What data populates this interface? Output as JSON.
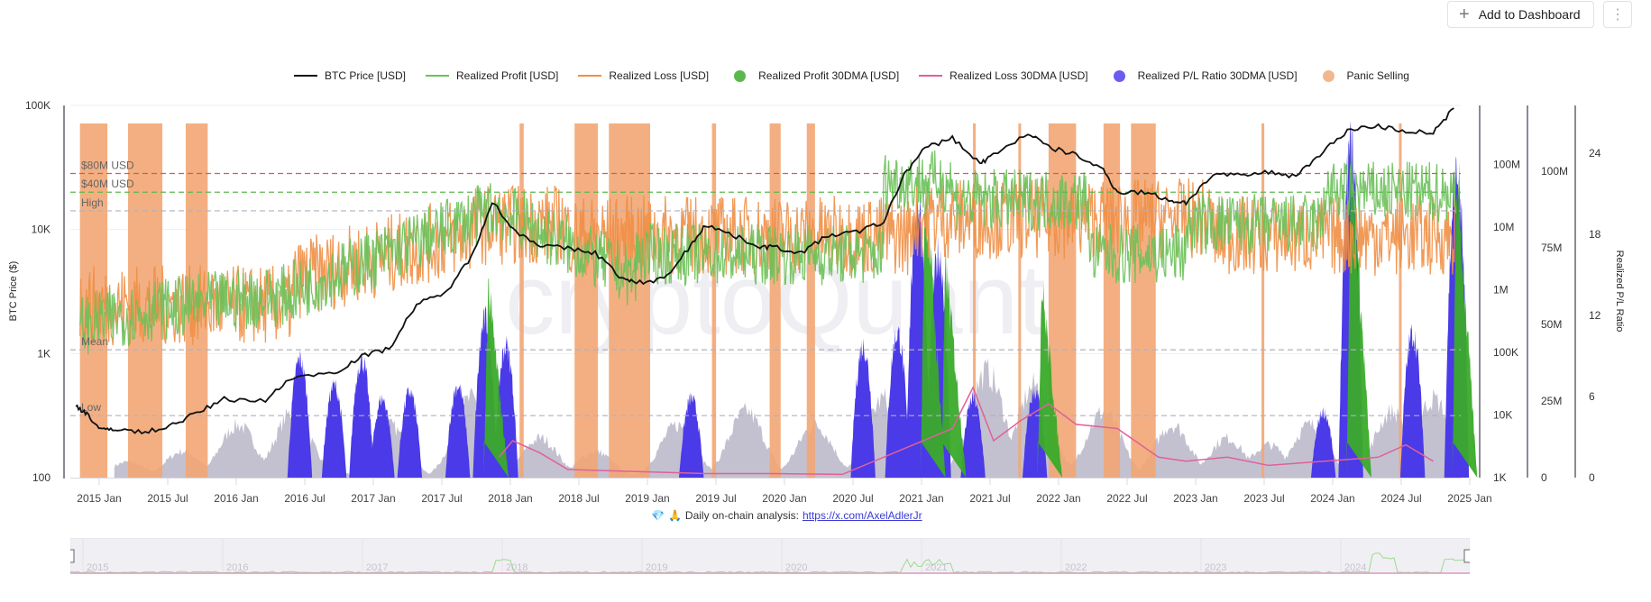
{
  "toolbar": {
    "add_dashboard_label": "Add to Dashboard",
    "add_icon": "plus-icon",
    "more_icon": "kebab-menu-icon"
  },
  "legend": [
    {
      "label": "BTC Price [USD]",
      "color": "#111111",
      "marker": "line"
    },
    {
      "label": "Realized Profit [USD]",
      "color": "#6cc15a",
      "marker": "line"
    },
    {
      "label": "Realized Loss [USD]",
      "color": "#ef8f45",
      "marker": "line"
    },
    {
      "label": "Realized Profit 30DMA [USD]",
      "color": "#5cb84c",
      "marker": "dot"
    },
    {
      "label": "Realized Loss 30DMA [USD]",
      "color": "#e0609a",
      "marker": "line"
    },
    {
      "label": "Realized P/L Ratio 30DMA [USD]",
      "color": "#6a5cf0",
      "marker": "dot"
    },
    {
      "label": "Panic Selling",
      "color": "#f2b78e",
      "marker": "dot"
    }
  ],
  "attribution": {
    "prefix": "Daily on-chain analysis:",
    "link": "https://x.com/AxelAdlerJr",
    "icons": [
      "diamond-icon",
      "praying-person-icon"
    ]
  },
  "watermark": "cryptoQuant",
  "chart_data": {
    "type": "line",
    "title": "",
    "x_range": [
      "2014-11",
      "2025-01"
    ],
    "x_ticks": [
      "2015 Jan",
      "2015 Jul",
      "2016 Jan",
      "2016 Jul",
      "2017 Jan",
      "2017 Jul",
      "2018 Jan",
      "2018 Jul",
      "2019 Jan",
      "2019 Jul",
      "2020 Jan",
      "2020 Jul",
      "2021 Jan",
      "2021 Jul",
      "2022 Jan",
      "2022 Jul",
      "2023 Jan",
      "2023 Jul",
      "2024 Jan",
      "2024 Jul",
      "2025 Jan"
    ],
    "axes": {
      "left": {
        "label": "BTC Price ($)",
        "scale": "log",
        "range": [
          100,
          100000
        ],
        "ticks": [
          "100",
          "1K",
          "10K",
          "100K"
        ]
      },
      "right1": {
        "label": "",
        "scale": "log",
        "range": [
          1000,
          1000000000
        ],
        "ticks": [
          "1K",
          "10K",
          "100K",
          "1M",
          "10M",
          "100M"
        ]
      },
      "right2": {
        "label": "",
        "scale": "linear",
        "range": [
          0,
          125000000
        ],
        "ticks": [
          "0",
          "25M",
          "50M",
          "75M",
          "100M"
        ]
      },
      "right3": {
        "label": "Realized P/L Ratio",
        "scale": "linear",
        "range": [
          0,
          27
        ],
        "ticks": [
          "0",
          "6",
          "12",
          "18",
          "24"
        ]
      }
    },
    "reference_lines": [
      {
        "label": "$80M USD",
        "axis": "right1",
        "value": 80000000,
        "color": "#e05555"
      },
      {
        "label": "$40M USD",
        "axis": "right1",
        "value": 40000000,
        "color": "#5cb84c"
      },
      {
        "label": "High",
        "axis": "right1",
        "value": 20000000,
        "color": "#b0b0c0"
      },
      {
        "label": "Mean",
        "axis": "right1",
        "value": 115000,
        "color": "#b0b0c0"
      },
      {
        "label": "Low",
        "axis": "right1",
        "value": 10000,
        "color": "#b0b0c0"
      }
    ],
    "series": [
      {
        "name": "BTC Price [USD]",
        "axis": "left",
        "color": "#111111",
        "x": [
          2014.92,
          2015.0,
          2015.1,
          2015.2,
          2015.4,
          2015.6,
          2015.8,
          2016.0,
          2016.3,
          2016.5,
          2016.8,
          2017.0,
          2017.2,
          2017.4,
          2017.6,
          2017.8,
          2017.95,
          2018.1,
          2018.3,
          2018.5,
          2018.7,
          2018.9,
          2019.0,
          2019.2,
          2019.4,
          2019.5,
          2019.7,
          2019.9,
          2020.0,
          2020.2,
          2020.4,
          2020.6,
          2020.8,
          2020.95,
          2021.1,
          2021.3,
          2021.5,
          2021.6,
          2021.85,
          2022.0,
          2022.2,
          2022.4,
          2022.5,
          2022.7,
          2022.9,
          2023.0,
          2023.2,
          2023.4,
          2023.6,
          2023.8,
          2024.0,
          2024.2,
          2024.4,
          2024.6,
          2024.8,
          2024.95
        ],
        "values": [
          380,
          330,
          240,
          250,
          230,
          260,
          330,
          430,
          420,
          650,
          700,
          950,
          1100,
          2500,
          3000,
          6000,
          17000,
          10000,
          7500,
          7000,
          6500,
          4000,
          3700,
          4000,
          7500,
          11000,
          9000,
          7300,
          7200,
          6500,
          9000,
          9500,
          11500,
          28000,
          45000,
          55000,
          34000,
          40000,
          60000,
          46000,
          40000,
          30000,
          20000,
          20000,
          17000,
          16500,
          28000,
          27000,
          29000,
          27000,
          43000,
          65000,
          68000,
          62000,
          60000,
          95000
        ]
      },
      {
        "name": "Realized Profit [USD]",
        "axis": "right1",
        "color": "#6cc15a",
        "note": "noisy daily values, approx envelope 1e5–5e8"
      },
      {
        "name": "Realized Loss [USD]",
        "axis": "right1",
        "color": "#ef8f45",
        "note": "noisy daily values, approx envelope 1e5–2e8"
      },
      {
        "name": "Realized Profit 30DMA [USD]",
        "axis": "right2",
        "color": "#3aaa2a",
        "spikes": [
          [
            2017.92,
            70000000
          ],
          [
            2021.1,
            108000000
          ],
          [
            2021.25,
            78000000
          ],
          [
            2021.95,
            70000000
          ],
          [
            2024.2,
            120000000
          ],
          [
            2024.97,
            110000000
          ]
        ]
      },
      {
        "name": "Realized Loss 30DMA [USD]",
        "axis": "right2",
        "color": "#e0609a",
        "x": [
          2018.0,
          2018.1,
          2018.3,
          2018.5,
          2019.0,
          2019.5,
          2020.0,
          2020.5,
          2021.3,
          2021.45,
          2021.6,
          2021.8,
          2022.0,
          2022.2,
          2022.5,
          2022.8,
          2023.0,
          2023.3,
          2023.6,
          2024.4,
          2024.6,
          2024.8
        ],
        "values": [
          5000000,
          9000000,
          6000000,
          2000000,
          1500000,
          1000000,
          1000000,
          800000,
          12000000,
          22000000,
          9000000,
          14000000,
          18000000,
          13000000,
          12000000,
          5000000,
          4000000,
          5000000,
          3000000,
          5000000,
          8000000,
          4000000
        ]
      },
      {
        "name": "Realized P/L Ratio 30DMA [USD]",
        "axis": "right3",
        "color": "#4a3ae8",
        "peaks": [
          [
            2016.55,
            9
          ],
          [
            2016.8,
            7
          ],
          [
            2017.0,
            9
          ],
          [
            2017.15,
            6
          ],
          [
            2017.35,
            6.5
          ],
          [
            2017.7,
            7
          ],
          [
            2017.9,
            12
          ],
          [
            2018.05,
            10
          ],
          [
            2019.4,
            6
          ],
          [
            2020.65,
            10
          ],
          [
            2020.9,
            11
          ],
          [
            2021.05,
            21
          ],
          [
            2021.2,
            17
          ],
          [
            2021.45,
            6
          ],
          [
            2021.9,
            6.5
          ],
          [
            2024.0,
            5
          ],
          [
            2024.2,
            25
          ],
          [
            2024.65,
            11
          ],
          [
            2024.97,
            23
          ]
        ]
      },
      {
        "name": "Realized P/L Ratio (gray area)",
        "axis": "right3",
        "color": "#b8b6c8",
        "peaks": [
          [
            2015.3,
            1.2
          ],
          [
            2015.7,
            2
          ],
          [
            2016.1,
            4
          ],
          [
            2016.5,
            5
          ],
          [
            2017.2,
            4
          ],
          [
            2017.8,
            6
          ],
          [
            2018.3,
            3
          ],
          [
            2018.7,
            2
          ],
          [
            2019.3,
            4
          ],
          [
            2019.8,
            5
          ],
          [
            2020.3,
            4
          ],
          [
            2020.8,
            6
          ],
          [
            2021.55,
            8
          ],
          [
            2021.9,
            7
          ],
          [
            2022.4,
            5
          ],
          [
            2022.9,
            4
          ],
          [
            2023.3,
            3
          ],
          [
            2023.6,
            2.5
          ],
          [
            2023.9,
            4
          ],
          [
            2024.5,
            5
          ],
          [
            2024.8,
            6
          ]
        ]
      },
      {
        "name": "Panic Selling",
        "axis": "left",
        "color": "#f2a673",
        "ranges": [
          [
            2014.95,
            2015.15
          ],
          [
            2015.3,
            2015.55
          ],
          [
            2015.72,
            2015.88
          ],
          [
            2018.15,
            2018.18
          ],
          [
            2018.55,
            2018.72
          ],
          [
            2018.8,
            2019.1
          ],
          [
            2019.55,
            2019.58
          ],
          [
            2019.97,
            2020.05
          ],
          [
            2020.24,
            2020.3
          ],
          [
            2021.45,
            2021.47
          ],
          [
            2021.78,
            2021.8
          ],
          [
            2022.0,
            2022.2
          ],
          [
            2022.4,
            2022.52
          ],
          [
            2022.6,
            2022.78
          ],
          [
            2023.55,
            2023.57
          ],
          [
            2024.55,
            2024.57
          ]
        ]
      }
    ]
  }
}
